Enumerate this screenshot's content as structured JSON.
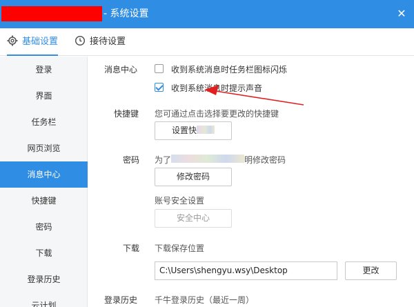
{
  "window": {
    "title": "- 系统设置",
    "close_glyph": "✕"
  },
  "tabs": [
    {
      "label": "基础设置",
      "icon": "gear-icon",
      "active": true
    },
    {
      "label": "接待设置",
      "icon": "clock-icon",
      "active": false
    }
  ],
  "sidebar": {
    "items": [
      {
        "label": "登录"
      },
      {
        "label": "界面"
      },
      {
        "label": "任务栏"
      },
      {
        "label": "网页浏览"
      },
      {
        "label": "消息中心",
        "active": true
      },
      {
        "label": "快捷键"
      },
      {
        "label": "密码"
      },
      {
        "label": "下载"
      },
      {
        "label": "登录历史"
      },
      {
        "label": "云计划"
      }
    ]
  },
  "message_center": {
    "label": "消息中心",
    "options": [
      {
        "label": "收到系统消息时任务栏图标闪烁",
        "checked": false
      },
      {
        "label": "收到系统消息时提示声音",
        "checked": true
      }
    ]
  },
  "shortcut": {
    "label": "快捷键",
    "hint": "您可通过点击选择要更改的快捷键",
    "button": "设置快"
  },
  "password": {
    "label": "密码",
    "hint_prefix": "为了",
    "hint_suffix": "明修改密码",
    "change_button": "修改密码",
    "account_security_label": "账号安全设置",
    "security_center_button": "安全中心"
  },
  "download": {
    "label": "下载",
    "save_location_label": "下载保存位置",
    "path": "C:\\Users\\shengyu.wsy\\Desktop",
    "change_button": "更改"
  },
  "login_history": {
    "label": "登录历史",
    "desc": "千牛登录历史（最近一周）"
  },
  "colors": {
    "accent": "#2f8de4",
    "annotation": "#e02020"
  }
}
